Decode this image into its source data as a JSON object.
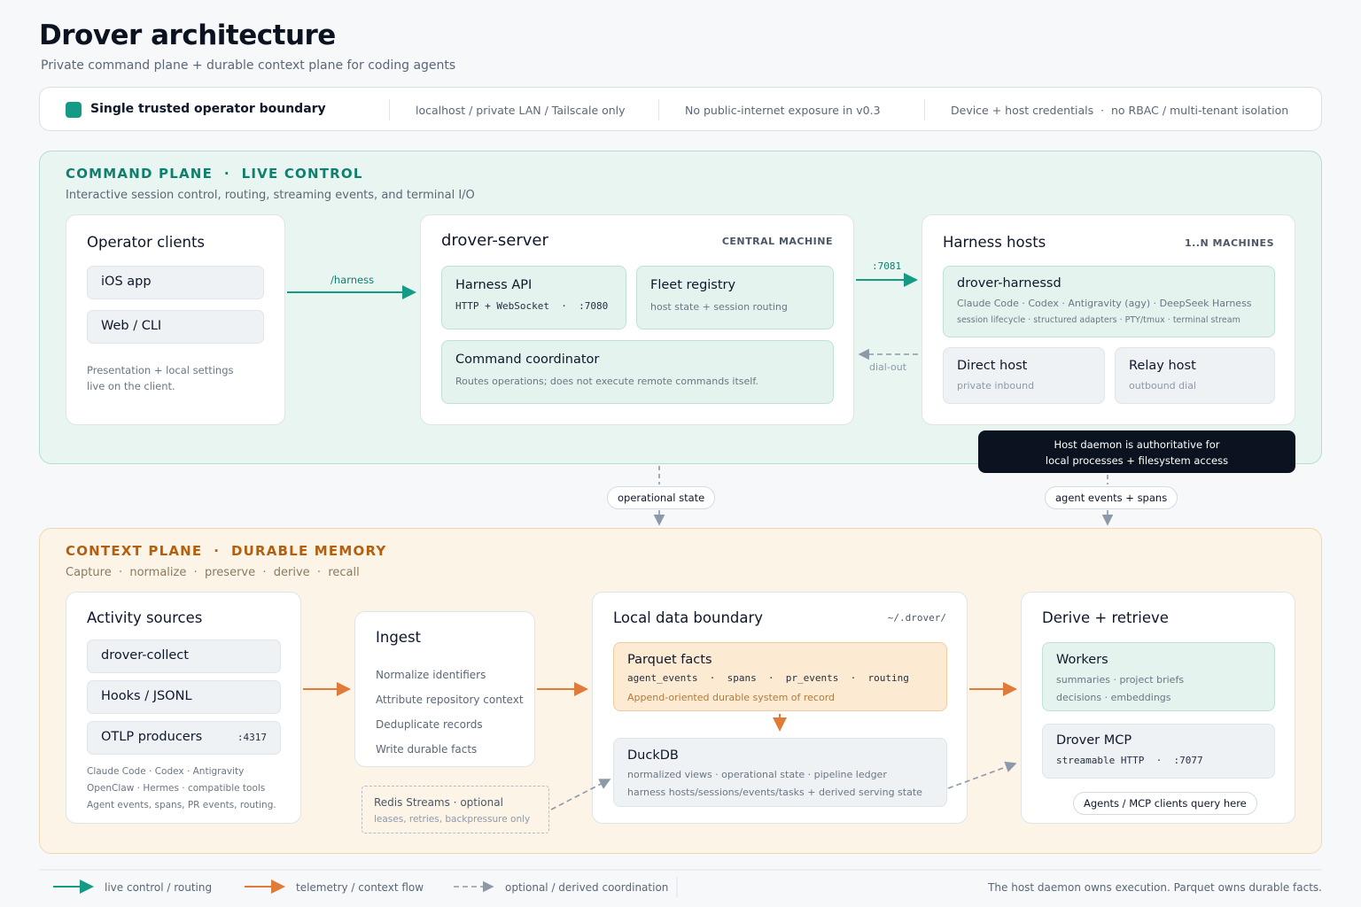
{
  "header": {
    "title": "Drover architecture",
    "subtitle": "Private command plane + durable context plane for coding agents"
  },
  "boundary": {
    "label": "Single trusted operator boundary",
    "items": [
      "localhost / private LAN / Tailscale only",
      "No public-internet exposure in v0.3",
      "Device + host credentials  ·  no RBAC / multi-tenant isolation"
    ]
  },
  "command_plane": {
    "title": "COMMAND PLANE  ·  LIVE CONTROL",
    "subtitle": "Interactive session control, routing, streaming events, and terminal I/O",
    "operator_clients": {
      "title": "Operator clients",
      "items": [
        "iOS app",
        "Web / CLI"
      ],
      "note_lines": [
        "Presentation + local settings",
        "live on the client."
      ]
    },
    "harness_arrow_label": "/harness",
    "server": {
      "title": "drover-server",
      "tag": "CENTRAL MACHINE",
      "harness_api": {
        "title": "Harness API",
        "sub": "HTTP + WebSocket  ·  :7080"
      },
      "fleet_registry": {
        "title": "Fleet registry",
        "sub": "host state + session routing"
      },
      "coordinator": {
        "title": "Command coordinator",
        "sub": "Routes operations; does not execute remote commands itself."
      }
    },
    "port_label": ":7081",
    "dialout_label": "dial-out",
    "harness_hosts": {
      "title": "Harness hosts",
      "tag": "1..N MACHINES",
      "harnessd": {
        "title": "drover-harnessd",
        "line1": "Claude Code · Codex · Antigravity (agy) · DeepSeek Harness",
        "line2": "session lifecycle · structured adapters · PTY/tmux · terminal stream"
      },
      "direct": {
        "title": "Direct host",
        "sub": "private inbound"
      },
      "relay": {
        "title": "Relay host",
        "sub": "outbound dial"
      }
    },
    "callout_lines": [
      "Host daemon is authoritative for",
      "local processes + filesystem access"
    ]
  },
  "connectors": {
    "left": "operational state",
    "right": "agent events + spans"
  },
  "context_plane": {
    "title": "CONTEXT PLANE  ·  DURABLE MEMORY",
    "subtitle": "Capture  ·  normalize  ·  preserve  ·  derive  ·  recall",
    "activity": {
      "title": "Activity sources",
      "items": [
        "drover-collect",
        "Hooks / JSONL",
        "OTLP producers"
      ],
      "otlp_port": ":4317",
      "note_lines": [
        "Claude Code · Codex · Antigravity",
        "OpenClaw · Hermes · compatible tools",
        "Agent events, spans, PR events, routing."
      ]
    },
    "ingest": {
      "title": "Ingest",
      "items": [
        "Normalize identifiers",
        "Attribute repository context",
        "Deduplicate records",
        "Write durable facts"
      ]
    },
    "redis": {
      "title": "Redis Streams · optional",
      "sub": "leases, retries, backpressure only"
    },
    "local_data": {
      "title": "Local data boundary",
      "path": "~/.drover/",
      "parquet": {
        "title": "Parquet facts",
        "fields": "agent_events  ·  spans  ·  pr_events  ·  routing",
        "sub": "Append-oriented durable system of record"
      },
      "duckdb": {
        "title": "DuckDB",
        "line1": "normalized views · operational state · pipeline ledger",
        "line2": "harness hosts/sessions/events/tasks + derived serving state"
      }
    },
    "derive": {
      "title": "Derive + retrieve",
      "workers": {
        "title": "Workers",
        "line1": "summaries · project briefs",
        "line2": "decisions · embeddings"
      },
      "mcp": {
        "title": "Drover MCP",
        "sub": "streamable HTTP  ·  :7077"
      },
      "chip": "Agents / MCP clients query here"
    }
  },
  "legend": {
    "live": "live control / routing",
    "telemetry": "telemetry / context flow",
    "optional": "optional / derived coordination",
    "note": "The host daemon owns execution. Parquet owns durable facts."
  },
  "colors": {
    "command_accent": "#159a86",
    "context_accent": "#b45f0d",
    "telemetry_arrow": "#e07b39",
    "dashed": "#8d99a8"
  }
}
